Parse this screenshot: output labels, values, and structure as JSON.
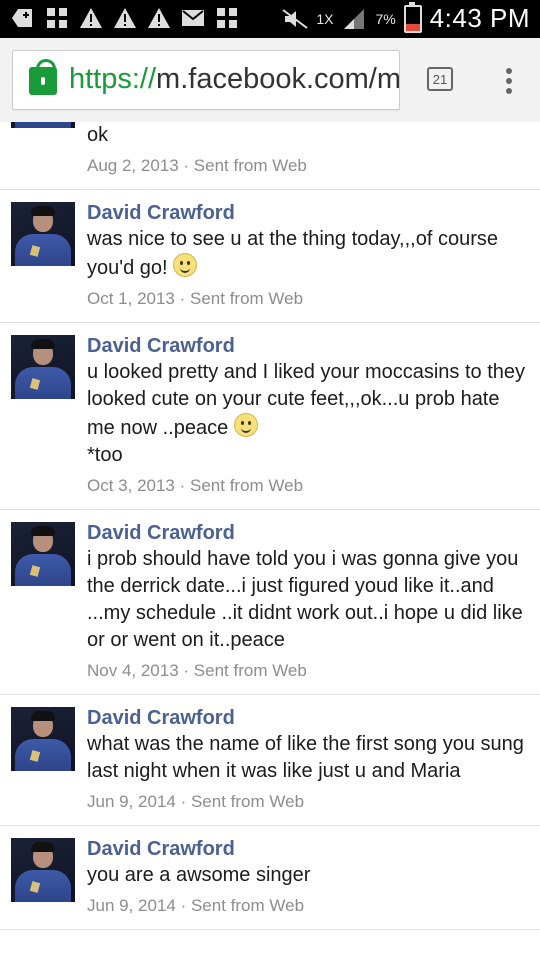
{
  "status_bar": {
    "left_icons": [
      "add-box-icon",
      "grid-app-icon",
      "warning-icon",
      "warning-icon",
      "warning-icon",
      "mail-icon",
      "grid-app-icon"
    ],
    "signal_text": "1X",
    "battery": "7%",
    "time": "4:43 PM"
  },
  "browser": {
    "url_scheme": "https://",
    "url_rest": "m.facebook.com/m",
    "tab_count": "21"
  },
  "messages": [
    {
      "name": "",
      "text": "ok",
      "meta": "Aug 2, 2013 · Sent from Web"
    },
    {
      "name": "David Crawford",
      "text": "was nice to see u at the thing today,,,of course you'd go!",
      "meta": "Oct 1, 2013 · Sent from Web"
    },
    {
      "name": "David Crawford",
      "text": "u looked pretty and I liked your moccasins to they looked cute on your cute feet,,,ok...u prob hate me now ..peace",
      "text2": "*too",
      "meta": "Oct 3, 2013 · Sent from Web"
    },
    {
      "name": "David Crawford",
      "text": "i prob should have told you i was gonna give you the derrick date...i just figured youd like it..and ...my schedule ..it didnt work out..i hope u did like or or went on it..peace",
      "meta": "Nov 4, 2013 · Sent from Web"
    },
    {
      "name": "David Crawford",
      "text": "what was the name of like the first song you sung last night when it was like just u and Maria",
      "meta": "Jun 9, 2014 · Sent from Web"
    },
    {
      "name": "David Crawford",
      "text": "you are a awsome singer",
      "meta": "Jun 9, 2014 · Sent from Web"
    }
  ],
  "colors": {
    "name_link": "#4b6193",
    "secure_green": "#1a9b3a"
  }
}
